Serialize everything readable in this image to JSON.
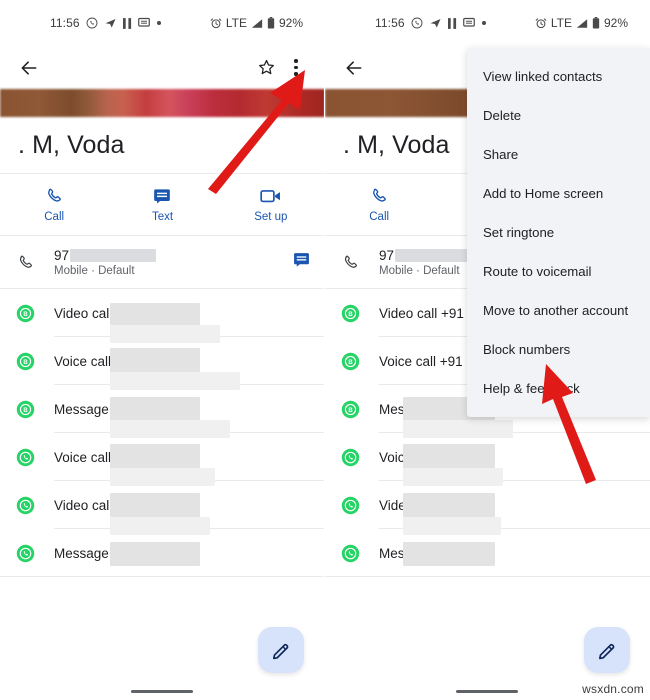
{
  "meta": {
    "watermark": "wsxdn.com"
  },
  "statusbar": {
    "time": "11:56",
    "network": "LTE",
    "battery": "92%",
    "icons": [
      "whatsapp-icon",
      "telegram-icon",
      "pause-icon",
      "message-icon",
      "dot-icon",
      "alarm-icon",
      "signal-icon",
      "battery-icon"
    ]
  },
  "appbar": {
    "back_label": "Back",
    "star_label": "Add to favorites",
    "overflow_label": "More options"
  },
  "contact": {
    "name": ". M, Voda",
    "phone_prefix": "97",
    "phone_subtitle": "Mobile · Default",
    "message_action_label": "Send message"
  },
  "quick_actions": {
    "left": [
      {
        "label": "Call",
        "icon": "phone-icon"
      },
      {
        "label": "Text",
        "icon": "message-icon"
      },
      {
        "label": "Set up",
        "icon": "video-camera-icon"
      }
    ],
    "right": [
      {
        "label": "Call",
        "icon": "phone-icon"
      }
    ]
  },
  "whatsapp_rows_left": [
    {
      "label": "Video call ·",
      "app": "whatsapp-business"
    },
    {
      "label": "Voice call +",
      "app": "whatsapp-business"
    },
    {
      "label": "Message +",
      "app": "whatsapp-business"
    },
    {
      "label": "Voice call ·",
      "app": "whatsapp"
    },
    {
      "label": "Video call ·",
      "app": "whatsapp"
    },
    {
      "label": "Message +",
      "app": "whatsapp"
    }
  ],
  "whatsapp_rows_right": [
    {
      "label": "Video call +91 97",
      "app": "whatsapp-business"
    },
    {
      "label": "Voice call +91 97",
      "app": "whatsapp-business"
    },
    {
      "label": "Message +91 9",
      "app": "whatsapp-business"
    },
    {
      "label": "Voice call +91 9",
      "app": "whatsapp"
    },
    {
      "label": "Video call +91 9",
      "app": "whatsapp"
    },
    {
      "label": "Message +91 9",
      "app": "whatsapp"
    }
  ],
  "overflow_menu": {
    "items": [
      "View linked contacts",
      "Delete",
      "Share",
      "Add to Home screen",
      "Set ringtone",
      "Route to voicemail",
      "Move to another account",
      "Block numbers",
      "Help & feedback"
    ]
  },
  "fab": {
    "label": "Edit contact",
    "icon": "pencil-icon"
  },
  "annotations": {
    "arrow_1_target": "overflow-menu-button",
    "arrow_2_target": "Block numbers",
    "color": "#e01b17"
  },
  "colors": {
    "accent_blue": "#1a56b0",
    "whatsapp_green": "#25d366",
    "arrow_red": "#e01b17",
    "menu_bg": "#f1f3f6",
    "fab_bg": "#d7e3fa",
    "divider": "#e8eaed"
  }
}
